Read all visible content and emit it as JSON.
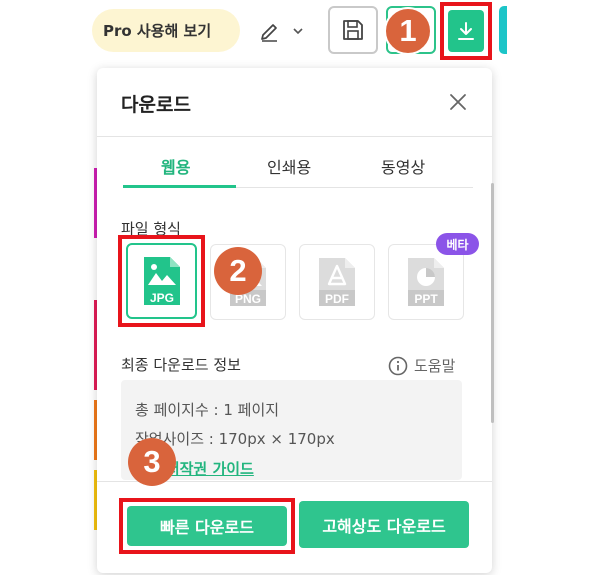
{
  "toolbar": {
    "pro_label": "Pro 사용해 보기",
    "accent_color": "#22c48b",
    "highlight_color": "#e8141b"
  },
  "badges": [
    "1",
    "2",
    "3"
  ],
  "panel": {
    "title": "다운로드",
    "tabs": [
      {
        "label": "웹용",
        "active": true
      },
      {
        "label": "인쇄용",
        "active": false
      },
      {
        "label": "동영상",
        "active": false
      }
    ],
    "format_label": "파일 형식",
    "formats": [
      {
        "label": "JPG",
        "selected": true
      },
      {
        "label": "PNG",
        "selected": false
      },
      {
        "label": "PDF",
        "selected": false
      },
      {
        "label": "PPT",
        "selected": false
      }
    ],
    "beta_label": "베타",
    "info_label": "최종 다운로드 정보",
    "help_label": "도움말",
    "info_pages": "총 페이지수 : 1 페이지",
    "info_size": "작업사이즈 : 170px × 170px",
    "info_guide": "쉬운 저작권 가이드",
    "quick_download": "빠른 다운로드",
    "hires_download": "고해상도 다운로드"
  }
}
